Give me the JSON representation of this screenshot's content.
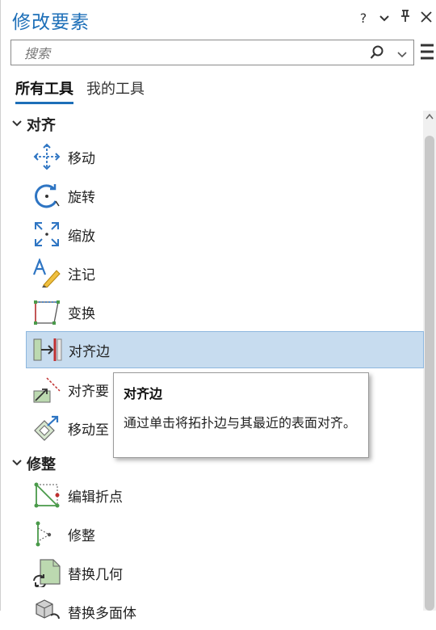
{
  "pane": {
    "title": "修改要素",
    "help_label": "?"
  },
  "search": {
    "placeholder": "搜索"
  },
  "tabs": [
    {
      "label": "所有工具"
    },
    {
      "label": "我的工具"
    }
  ],
  "groups": [
    {
      "label": "对齐",
      "tools": [
        {
          "label": "移动"
        },
        {
          "label": "旋转"
        },
        {
          "label": "缩放"
        },
        {
          "label": "注记"
        },
        {
          "label": "变换"
        },
        {
          "label": "对齐边"
        },
        {
          "label": "对齐要"
        },
        {
          "label": "移动至"
        }
      ]
    },
    {
      "label": "修整",
      "tools": [
        {
          "label": "编辑折点"
        },
        {
          "label": "修整"
        },
        {
          "label": "替换几何"
        },
        {
          "label": "替换多面体"
        }
      ]
    }
  ],
  "tooltip": {
    "title": "对齐边",
    "body": "通过单击将拓扑边与其最近的表面对齐。"
  },
  "colors": {
    "accent": "#1d6fb8",
    "selected_bg": "#c7dcef",
    "icon_blue": "#2e75c3",
    "icon_green": "#4a9a4a"
  }
}
